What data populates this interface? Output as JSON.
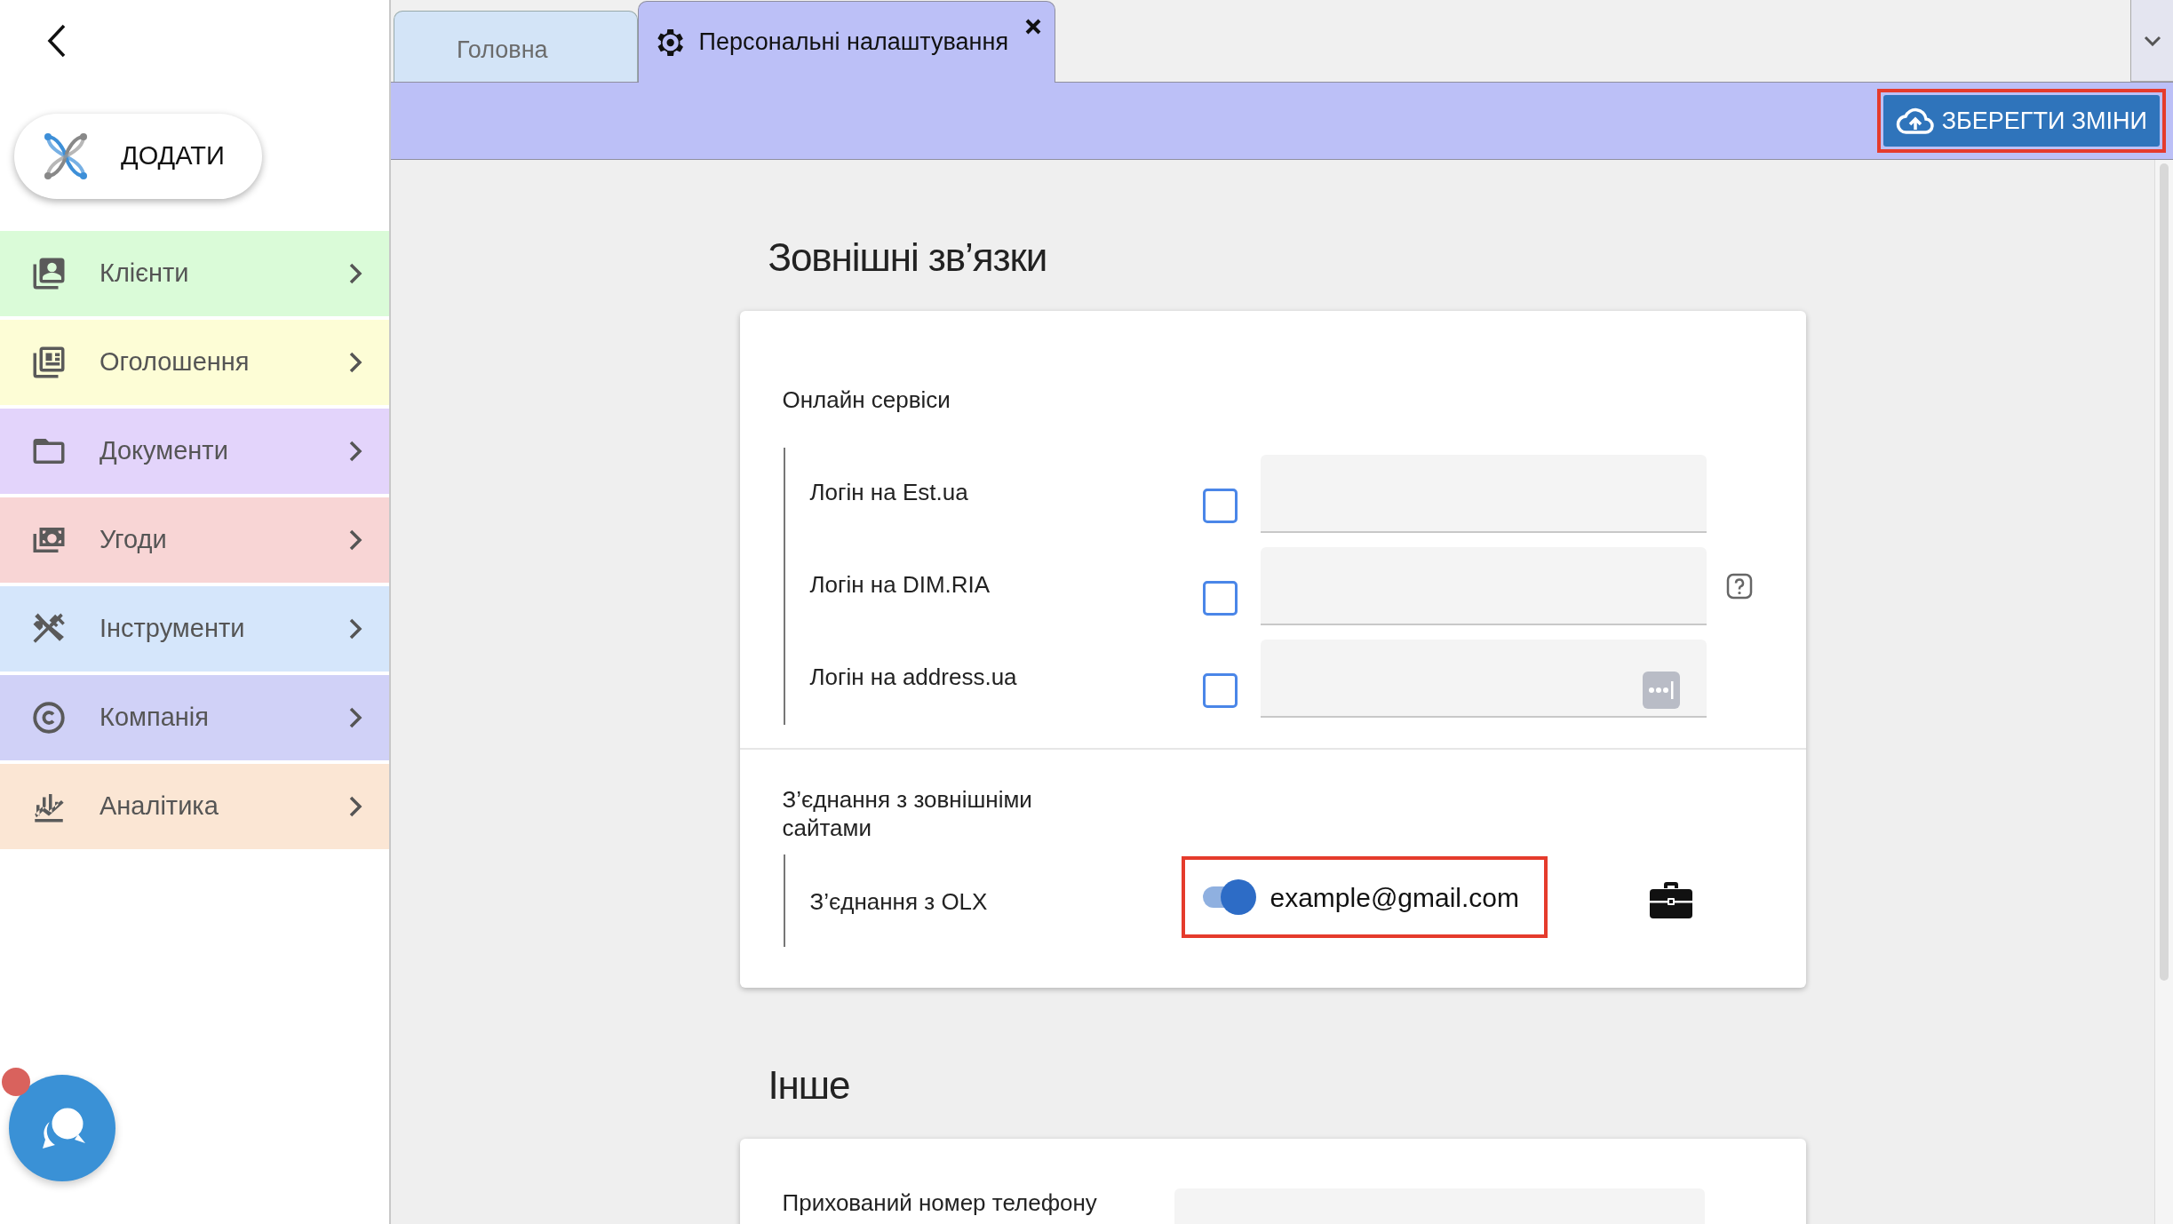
{
  "sidebar": {
    "add_button": "ДОДАТИ",
    "items": [
      {
        "label": "Клієнти",
        "color": "#dafbd8"
      },
      {
        "label": "Оголошення",
        "color": "#fdfdd6"
      },
      {
        "label": "Документи",
        "color": "#e3d4fb"
      },
      {
        "label": "Угоди",
        "color": "#f8d5d5"
      },
      {
        "label": "Інструменти",
        "color": "#d5e6fb"
      },
      {
        "label": "Компанія",
        "color": "#d0d1f7"
      },
      {
        "label": "Аналітика",
        "color": "#fbe6d4"
      }
    ],
    "chat_badge": true
  },
  "tabs": [
    {
      "label": "Головна",
      "selected": false,
      "closable": false
    },
    {
      "label": "Персональні налаштування",
      "selected": true,
      "closable": true
    }
  ],
  "toolbar": {
    "save_button": "ЗБЕРЕГТИ ЗМІНИ",
    "highlighted": true
  },
  "sections": [
    {
      "title": "Зовнішні зв’язки",
      "groups": [
        {
          "title": "Онлайн сервіси",
          "rows": [
            {
              "kind": "login",
              "label": "Логін на Est.ua",
              "checked": false
            },
            {
              "kind": "login",
              "label": "Логін на DIM.RIA",
              "checked": false,
              "help": true
            },
            {
              "kind": "login",
              "label": "Логін на address.ua",
              "checked": false,
              "autofill": true
            }
          ]
        },
        {
          "title": "З’єднання з зовнішніми сайтами",
          "rows": [
            {
              "kind": "connection",
              "label": "З’єднання з OLX",
              "on": true,
              "value": "example@gmail.com",
              "highlighted": true
            }
          ]
        }
      ]
    },
    {
      "title": "Інше",
      "groups": [
        {
          "rows": [
            {
              "kind": "field",
              "label": "Прихований номер телефону"
            }
          ]
        }
      ]
    }
  ]
}
